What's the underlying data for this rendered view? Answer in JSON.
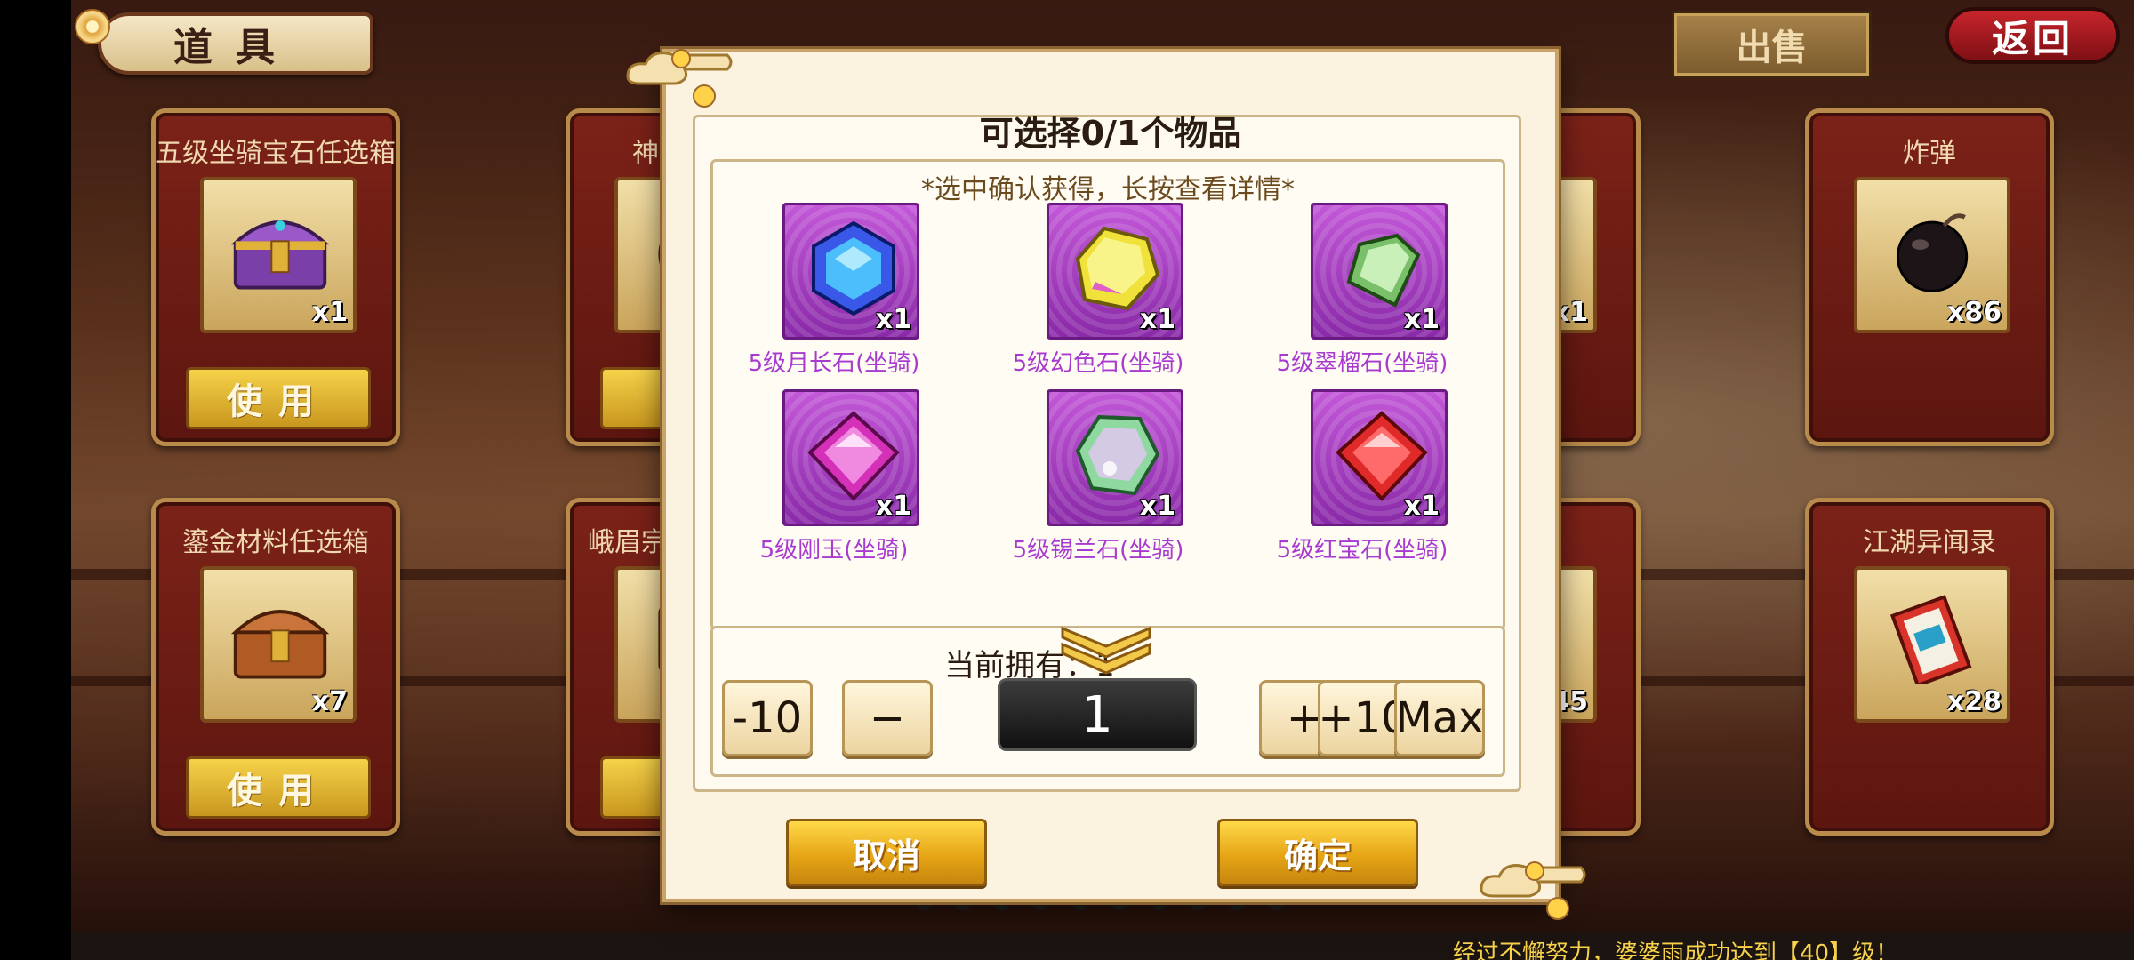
{
  "header": {
    "title": "道具",
    "sell_label": "出售",
    "back_label": "返回"
  },
  "inventory": [
    {
      "name": "五级坐骑宝石任选箱",
      "count": "x1",
      "use_label": "使用",
      "icon": "treasure-chest-icon"
    },
    {
      "name": "神",
      "count": "",
      "use_label": "使",
      "icon": "mask-icon"
    },
    {
      "name": "",
      "count": "x1",
      "use_label": "",
      "icon": "partial-item-icon"
    },
    {
      "name": "炸弹",
      "count": "x86",
      "use_label": "",
      "icon": "bomb-icon"
    },
    {
      "name": "鎏金材料任选箱",
      "count": "x7",
      "use_label": "使用",
      "icon": "treasure-chest-icon"
    },
    {
      "name": "峨眉宗",
      "count": "",
      "use_label": "使",
      "icon": "scroll-item-icon"
    },
    {
      "name": "",
      "count": "45",
      "use_label": "",
      "icon": "leaf-icon"
    },
    {
      "name": "江湖异闻录",
      "count": "x28",
      "use_label": "",
      "icon": "book-icon"
    }
  ],
  "modal": {
    "title": "可选择0/1个物品",
    "hint": "*选中确认获得，长按查看详情*",
    "items": [
      {
        "name": "5级月长石(坐骑)",
        "count": "x1",
        "color": "#3a7cff",
        "icon": "moonstone-gem-icon"
      },
      {
        "name": "5级幻色石(坐骑)",
        "count": "x1",
        "color": "#e8e040",
        "icon": "phantom-gem-icon"
      },
      {
        "name": "5级翠榴石(坐骑)",
        "count": "x1",
        "color": "#8fd27a",
        "icon": "demantoid-gem-icon"
      },
      {
        "name": "5级刚玉(坐骑)",
        "count": "x1",
        "color": "#e040c0",
        "icon": "corundum-gem-icon"
      },
      {
        "name": "5级锡兰石(坐骑)",
        "count": "x1",
        "color": "#9be0a8",
        "icon": "ceylonite-gem-icon"
      },
      {
        "name": "5级红宝石(坐骑)",
        "count": "x1",
        "color": "#e02a2a",
        "icon": "ruby-gem-icon"
      }
    ],
    "owned_label": "当前拥有：1",
    "quantity": "1",
    "buttons": {
      "minus10": "-10",
      "minus": "−",
      "plus": "+",
      "plus10": "+10",
      "max": "Max",
      "cancel": "取消",
      "confirm": "确定"
    }
  },
  "notice": "经过不懈努力，婆婆雨成功达到【40】级！"
}
